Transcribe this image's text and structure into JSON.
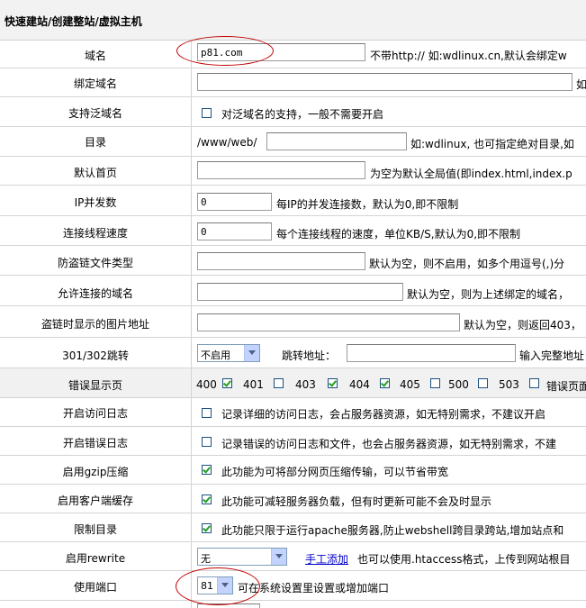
{
  "header": {
    "title": "快速建站/创建整站/虚拟主机"
  },
  "domain": {
    "label": "域名",
    "value": "p81.com",
    "hint": "不带http:// 如:wdlinux.cn,默认会绑定w"
  },
  "bind_domain": {
    "label": "绑定域名",
    "value": "",
    "hint": "如"
  },
  "wildcard": {
    "label": "支持泛域名",
    "checked": false,
    "text": "对泛域名的支持，一般不需要开启"
  },
  "directory": {
    "label": "目录",
    "prefix": "/www/web/",
    "value": "",
    "hint": "如:wdlinux, 也可指定绝对目录,如"
  },
  "index_page": {
    "label": "默认首页",
    "value": "",
    "hint": "为空为默认全局值(即index.html,index.p"
  },
  "ip_concurrency": {
    "label": "IP并发数",
    "value": "0",
    "hint": "每IP的并发连接数，默认为0,即不限制"
  },
  "conn_speed": {
    "label": "连接线程速度",
    "value": "0",
    "hint": "每个连接线程的速度，单位KB/S,默认为0,即不限制"
  },
  "hotlink_types": {
    "label": "防盗链文件类型",
    "value": "",
    "hint": "默认为空，则不启用，如多个用逗号(,)分"
  },
  "allowed_domains": {
    "label": "允许连接的域名",
    "value": "",
    "hint": "默认为空，则为上述绑定的域名，"
  },
  "hotlink_image": {
    "label": "盗链时显示的图片地址",
    "value": "",
    "hint": "默认为空，则返回403，"
  },
  "redirect": {
    "label": "301/302跳转",
    "select_value": "不启用",
    "target_label": "跳转地址：",
    "target_value": "",
    "hint": "输入完整地址"
  },
  "error_pages": {
    "label": "错误显示页",
    "codes": [
      {
        "code": "400",
        "checked": true
      },
      {
        "code": "401",
        "checked": false
      },
      {
        "code": "403",
        "checked": true
      },
      {
        "code": "404",
        "checked": true
      },
      {
        "code": "405",
        "checked": false
      },
      {
        "code": "500",
        "checked": false
      },
      {
        "code": "503",
        "checked": false
      }
    ],
    "tail": "错误页面"
  },
  "access_log": {
    "label": "开启访问日志",
    "checked": false,
    "text": "记录详细的访问日志，会占服务器资源，如无特别需求，不建议开启"
  },
  "error_log": {
    "label": "开启错误日志",
    "checked": false,
    "text": "记录错误的访问日志和文件，也会占服务器资源，如无特别需求，不建"
  },
  "gzip": {
    "label": "启用gzip压缩",
    "checked": true,
    "text": "此功能为可将部分网页压缩传输，可以节省带宽"
  },
  "client_cache": {
    "label": "启用客户端缓存",
    "checked": true,
    "text": "此功能可减轻服务器负载，但有时更新可能不会及时显示"
  },
  "restrict_dir": {
    "label": "限制目录",
    "checked": true,
    "text": "此功能只限于运行apache服务器,防止webshell跨目录跨站,增加站点和"
  },
  "rewrite": {
    "label": "启用rewrite",
    "select_value": "无",
    "link_text": "手工添加",
    "hint": "也可以使用.htaccess格式，上传到网站根目"
  },
  "port": {
    "label": "使用端口",
    "select_value": "81",
    "hint": "可在系统设置里设置或增加端口"
  },
  "colors": {
    "accent_link": "#0000cc",
    "highlight_oval": "#c00000",
    "shade_row": "#f1f1f1",
    "header_bg": "#f2f2f2"
  }
}
